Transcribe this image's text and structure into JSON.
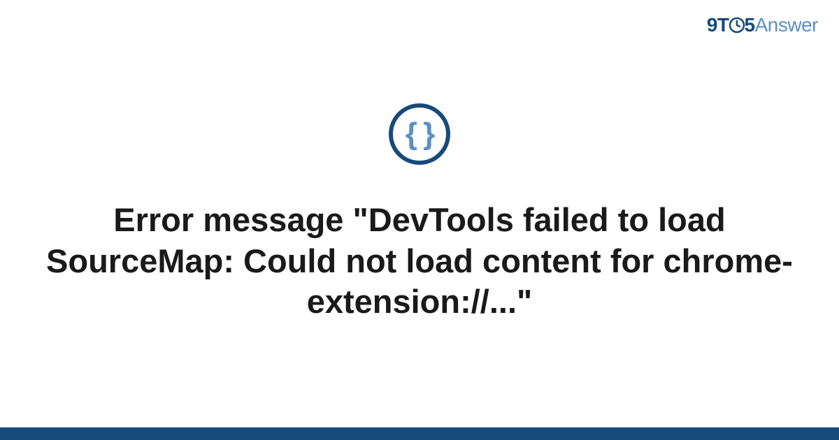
{
  "header": {
    "logo": {
      "part1": "9T",
      "part2": "5",
      "part3": "Answer"
    }
  },
  "main": {
    "icon_braces": "{ }",
    "title": "Error message \"DevTools failed to load SourceMap: Could not load content for chrome-extension://...\""
  },
  "colors": {
    "primary": "#174a7c",
    "secondary": "#5a8fc7",
    "text": "#1a1a1a"
  }
}
